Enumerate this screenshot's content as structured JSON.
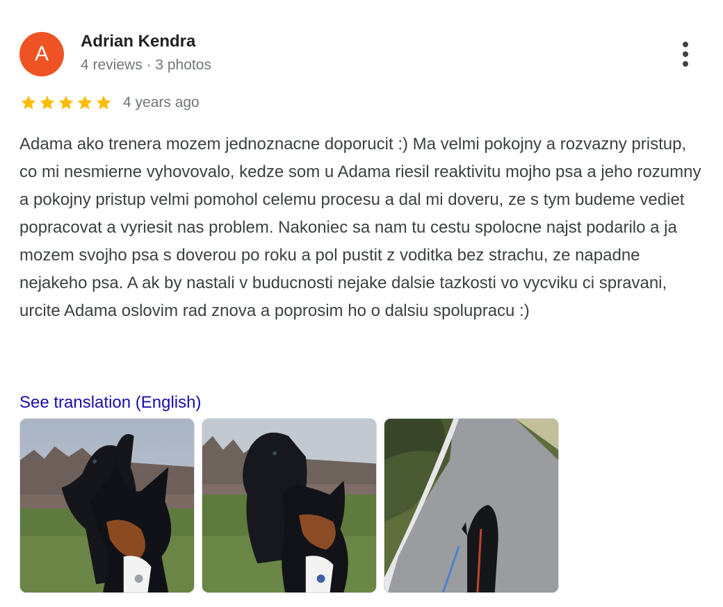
{
  "author": {
    "initial": "A",
    "name": "Adrian Kendra",
    "meta": "4 reviews · 3 photos",
    "avatar_color": "#ef5323"
  },
  "more_icon": "more-vert-icon",
  "rating": {
    "stars": 5,
    "max_stars": 5,
    "star_color": "#fbbc04",
    "date": "4 years ago"
  },
  "review": {
    "text": "Adama ako trenera mozem jednoznacne doporucit :) Ma velmi pokojny a rozvazny pristup, co mi nesmierne vyhovovalo, kedze som u Adama riesil reaktivitu mojho psa a jeho rozumny a pokojny pristup velmi pomohol celemu procesu a dal mi doveru, ze s tym budeme vediet popracovat a vyriesit nas problem. Nakoniec sa nam tu cestu spolocne najst podarilo a ja mozem svojho psa s doverou po roku a pol pustit z voditka bez strachu, ze napadne nejakeho psa. A ak by nastali v buducnosti nejake dalsie tazkosti vo vycviku ci spravani, urcite Adama oslovim rad znova a poprosim ho o dalsiu spolupracu :)",
    "translate_label": "See translation (English)",
    "link_color": "#1a0dab"
  },
  "photos": [
    {
      "name": "photo-two-dogs-close"
    },
    {
      "name": "photo-two-dogs-field"
    },
    {
      "name": "photo-dog-on-path"
    }
  ]
}
